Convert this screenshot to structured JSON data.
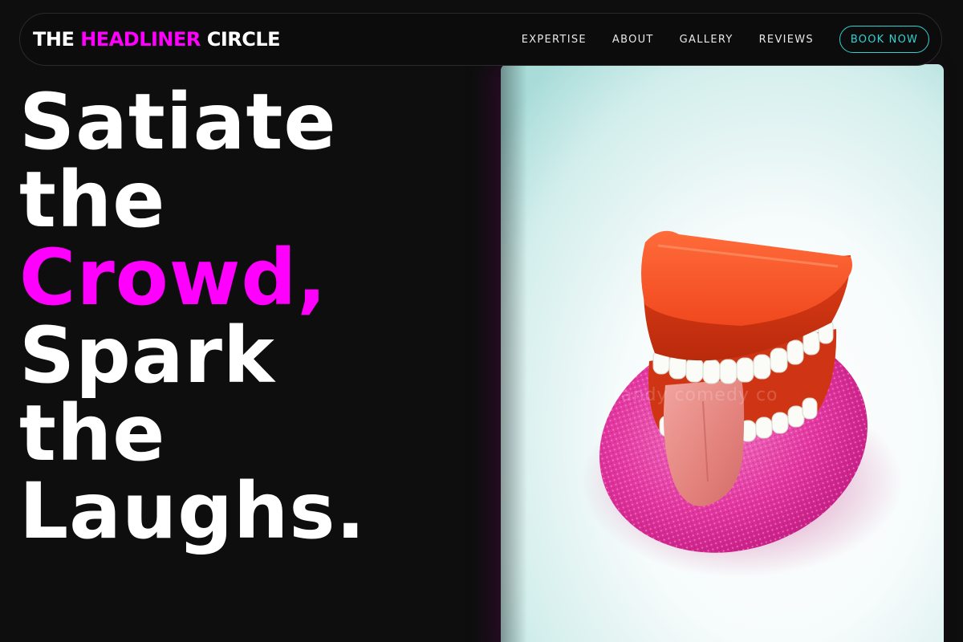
{
  "theme": {
    "accent": "#ff00ff",
    "cta": "#2fd3d3",
    "background": "#0e0e0e"
  },
  "nav": {
    "brand_part1": "THE ",
    "brand_accent": "HEADLINER",
    "brand_part2": " CIRCLE",
    "links": [
      {
        "label": "EXPERTISE"
      },
      {
        "label": "ABOUT"
      },
      {
        "label": "GALLERY"
      },
      {
        "label": "REVIEWS"
      }
    ],
    "cta_label": "BOOK NOW"
  },
  "hero": {
    "lines": [
      "Satiate",
      "the",
      "Crowd,",
      "Spark",
      "the",
      "Laughs."
    ],
    "image_icon": "chattering-teeth-toy-photo",
    "watermark": "randy comedy co"
  }
}
